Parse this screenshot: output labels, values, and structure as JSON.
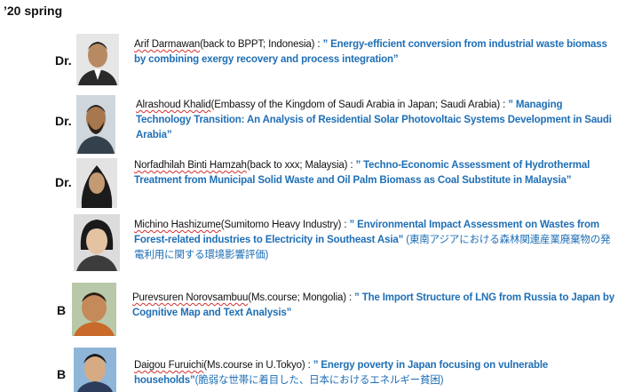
{
  "header": {
    "season": "’20 spring"
  },
  "entries": [
    {
      "degree": "Dr.",
      "name": "Arif Darmawan",
      "affiliation": "(back to BPPT; Indonesia) : ",
      "title": "” Energy-efficient conversion from industrial waste biomass by combining exergy recovery and process integration”",
      "note": ""
    },
    {
      "degree": "Dr.",
      "name": "Alrashoud Khalid",
      "affiliation": "(Embassy of the Kingdom of Saudi Arabia in Japan; Saudi Arabia) : ",
      "title": "” Managing Technology Transition: An Analysis of Residential Solar Photovoltaic Systems Development in Saudi Arabia”",
      "note": ""
    },
    {
      "degree": "Dr.",
      "name": "Norfadhilah Binti Hamzah",
      "affiliation": "(back to xxx; Malaysia) : ",
      "title": "” Techno-Economic Assessment of Hydrothermal Treatment from Municipal Solid Waste and Oil Palm Biomass as Coal Substitute in Malaysia”",
      "note": ""
    },
    {
      "degree": "",
      "name": "Michino Hashizume",
      "affiliation": "(Sumitomo Heavy Industry) : ",
      "title": "” Environmental Impact Assessment on Wastes from Forest-related industries to Electricity in Southeast Asia” ",
      "note": "(東南アジアにおける森林関連産業廃棄物の発電利用に関する環境影響評価)"
    },
    {
      "degree": "B",
      "name": "Purevsuren Norovsambuu",
      "affiliation": "(Ms.course; Mongolia) : ",
      "title": "” The Import Structure of LNG from Russia to Japan by Cognitive Map and Text Analysis”",
      "note": ""
    },
    {
      "degree": "B",
      "name": "Daigou Furuichi",
      "affiliation": "(Ms.course in U.Tokyo) : ",
      "title": "” Energy poverty in Japan focusing on vulnerable households”",
      "note": "(脆弱な世帯に着目した、日本におけるエネルギー貧困)"
    }
  ]
}
